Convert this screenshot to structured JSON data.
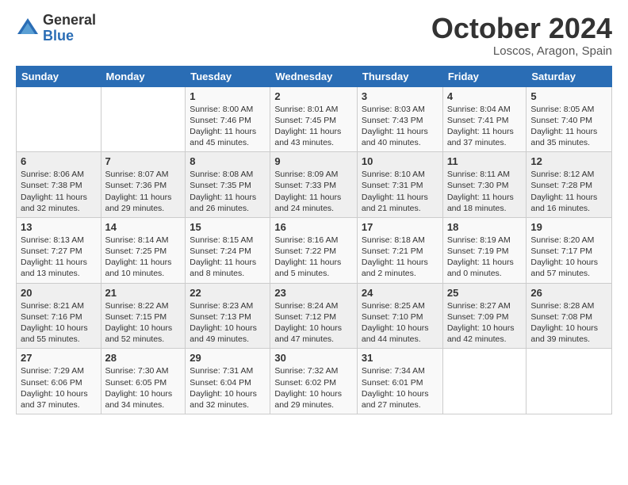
{
  "logo": {
    "general": "General",
    "blue": "Blue"
  },
  "header": {
    "month": "October 2024",
    "location": "Loscos, Aragon, Spain"
  },
  "weekdays": [
    "Sunday",
    "Monday",
    "Tuesday",
    "Wednesday",
    "Thursday",
    "Friday",
    "Saturday"
  ],
  "weeks": [
    [
      {
        "day": "",
        "info": ""
      },
      {
        "day": "",
        "info": ""
      },
      {
        "day": "1",
        "info": "Sunrise: 8:00 AM\nSunset: 7:46 PM\nDaylight: 11 hours and 45 minutes."
      },
      {
        "day": "2",
        "info": "Sunrise: 8:01 AM\nSunset: 7:45 PM\nDaylight: 11 hours and 43 minutes."
      },
      {
        "day": "3",
        "info": "Sunrise: 8:03 AM\nSunset: 7:43 PM\nDaylight: 11 hours and 40 minutes."
      },
      {
        "day": "4",
        "info": "Sunrise: 8:04 AM\nSunset: 7:41 PM\nDaylight: 11 hours and 37 minutes."
      },
      {
        "day": "5",
        "info": "Sunrise: 8:05 AM\nSunset: 7:40 PM\nDaylight: 11 hours and 35 minutes."
      }
    ],
    [
      {
        "day": "6",
        "info": "Sunrise: 8:06 AM\nSunset: 7:38 PM\nDaylight: 11 hours and 32 minutes."
      },
      {
        "day": "7",
        "info": "Sunrise: 8:07 AM\nSunset: 7:36 PM\nDaylight: 11 hours and 29 minutes."
      },
      {
        "day": "8",
        "info": "Sunrise: 8:08 AM\nSunset: 7:35 PM\nDaylight: 11 hours and 26 minutes."
      },
      {
        "day": "9",
        "info": "Sunrise: 8:09 AM\nSunset: 7:33 PM\nDaylight: 11 hours and 24 minutes."
      },
      {
        "day": "10",
        "info": "Sunrise: 8:10 AM\nSunset: 7:31 PM\nDaylight: 11 hours and 21 minutes."
      },
      {
        "day": "11",
        "info": "Sunrise: 8:11 AM\nSunset: 7:30 PM\nDaylight: 11 hours and 18 minutes."
      },
      {
        "day": "12",
        "info": "Sunrise: 8:12 AM\nSunset: 7:28 PM\nDaylight: 11 hours and 16 minutes."
      }
    ],
    [
      {
        "day": "13",
        "info": "Sunrise: 8:13 AM\nSunset: 7:27 PM\nDaylight: 11 hours and 13 minutes."
      },
      {
        "day": "14",
        "info": "Sunrise: 8:14 AM\nSunset: 7:25 PM\nDaylight: 11 hours and 10 minutes."
      },
      {
        "day": "15",
        "info": "Sunrise: 8:15 AM\nSunset: 7:24 PM\nDaylight: 11 hours and 8 minutes."
      },
      {
        "day": "16",
        "info": "Sunrise: 8:16 AM\nSunset: 7:22 PM\nDaylight: 11 hours and 5 minutes."
      },
      {
        "day": "17",
        "info": "Sunrise: 8:18 AM\nSunset: 7:21 PM\nDaylight: 11 hours and 2 minutes."
      },
      {
        "day": "18",
        "info": "Sunrise: 8:19 AM\nSunset: 7:19 PM\nDaylight: 11 hours and 0 minutes."
      },
      {
        "day": "19",
        "info": "Sunrise: 8:20 AM\nSunset: 7:17 PM\nDaylight: 10 hours and 57 minutes."
      }
    ],
    [
      {
        "day": "20",
        "info": "Sunrise: 8:21 AM\nSunset: 7:16 PM\nDaylight: 10 hours and 55 minutes."
      },
      {
        "day": "21",
        "info": "Sunrise: 8:22 AM\nSunset: 7:15 PM\nDaylight: 10 hours and 52 minutes."
      },
      {
        "day": "22",
        "info": "Sunrise: 8:23 AM\nSunset: 7:13 PM\nDaylight: 10 hours and 49 minutes."
      },
      {
        "day": "23",
        "info": "Sunrise: 8:24 AM\nSunset: 7:12 PM\nDaylight: 10 hours and 47 minutes."
      },
      {
        "day": "24",
        "info": "Sunrise: 8:25 AM\nSunset: 7:10 PM\nDaylight: 10 hours and 44 minutes."
      },
      {
        "day": "25",
        "info": "Sunrise: 8:27 AM\nSunset: 7:09 PM\nDaylight: 10 hours and 42 minutes."
      },
      {
        "day": "26",
        "info": "Sunrise: 8:28 AM\nSunset: 7:08 PM\nDaylight: 10 hours and 39 minutes."
      }
    ],
    [
      {
        "day": "27",
        "info": "Sunrise: 7:29 AM\nSunset: 6:06 PM\nDaylight: 10 hours and 37 minutes."
      },
      {
        "day": "28",
        "info": "Sunrise: 7:30 AM\nSunset: 6:05 PM\nDaylight: 10 hours and 34 minutes."
      },
      {
        "day": "29",
        "info": "Sunrise: 7:31 AM\nSunset: 6:04 PM\nDaylight: 10 hours and 32 minutes."
      },
      {
        "day": "30",
        "info": "Sunrise: 7:32 AM\nSunset: 6:02 PM\nDaylight: 10 hours and 29 minutes."
      },
      {
        "day": "31",
        "info": "Sunrise: 7:34 AM\nSunset: 6:01 PM\nDaylight: 10 hours and 27 minutes."
      },
      {
        "day": "",
        "info": ""
      },
      {
        "day": "",
        "info": ""
      }
    ]
  ]
}
